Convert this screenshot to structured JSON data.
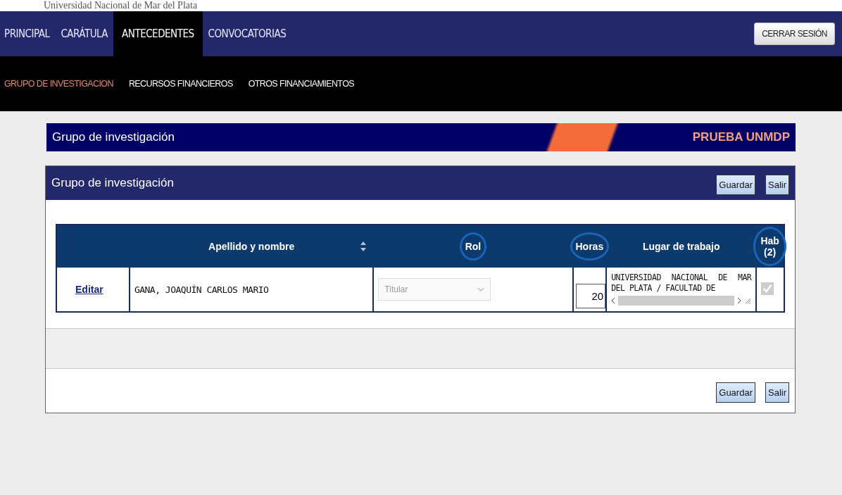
{
  "institution": "Universidad Nacional de Mar del Plata",
  "main_nav": [
    {
      "label": "PRINCIPAL",
      "selected": false
    },
    {
      "label": "CARÁTULA",
      "selected": false
    },
    {
      "label": "ANTECEDENTES",
      "selected": true
    },
    {
      "label": "CONVOCATORIAS",
      "selected": false
    }
  ],
  "logout_button": "CERRAR SESIÓN",
  "sub_nav": [
    {
      "label": "GRUPO DE INVESTIGACION",
      "selected": true
    },
    {
      "label": "RECURSOS FINANCIEROS",
      "selected": false
    },
    {
      "label": "OTROS FINANCIAMIENTOS",
      "selected": false
    }
  ],
  "banner": {
    "title": "Grupo de investigación",
    "project": "PRUEBA UNMDP"
  },
  "panel": {
    "title": "Grupo de investigación",
    "buttons": [
      "Guardar",
      "Salir"
    ],
    "table": {
      "columns": [
        {
          "sortable": false,
          "circled": false
        },
        {
          "label": "Apellido y nombre",
          "sortable": true,
          "circled": false
        },
        {
          "label": "Rol",
          "sortable": false,
          "circled": true
        },
        {
          "label": "Horas",
          "sortable": false,
          "circled": true
        },
        {
          "label": "Lugar de trabajo",
          "sortable": false,
          "circled": false
        },
        {
          "label": "Hab (2)",
          "sortable": false,
          "circled": true
        }
      ],
      "rows": [
        {
          "action": "Editar",
          "name": "GANA, JOAQUÍN CARLOS MARIO",
          "rol": "Titular",
          "horas": "20",
          "lugar": "UNIVERSIDAD NACIONAL DE MAR DEL PLATA / FACULTAD DE",
          "hab_checked": true,
          "hab_disabled": true
        }
      ]
    },
    "footer_buttons": [
      "Guardar",
      "Salir"
    ]
  }
}
